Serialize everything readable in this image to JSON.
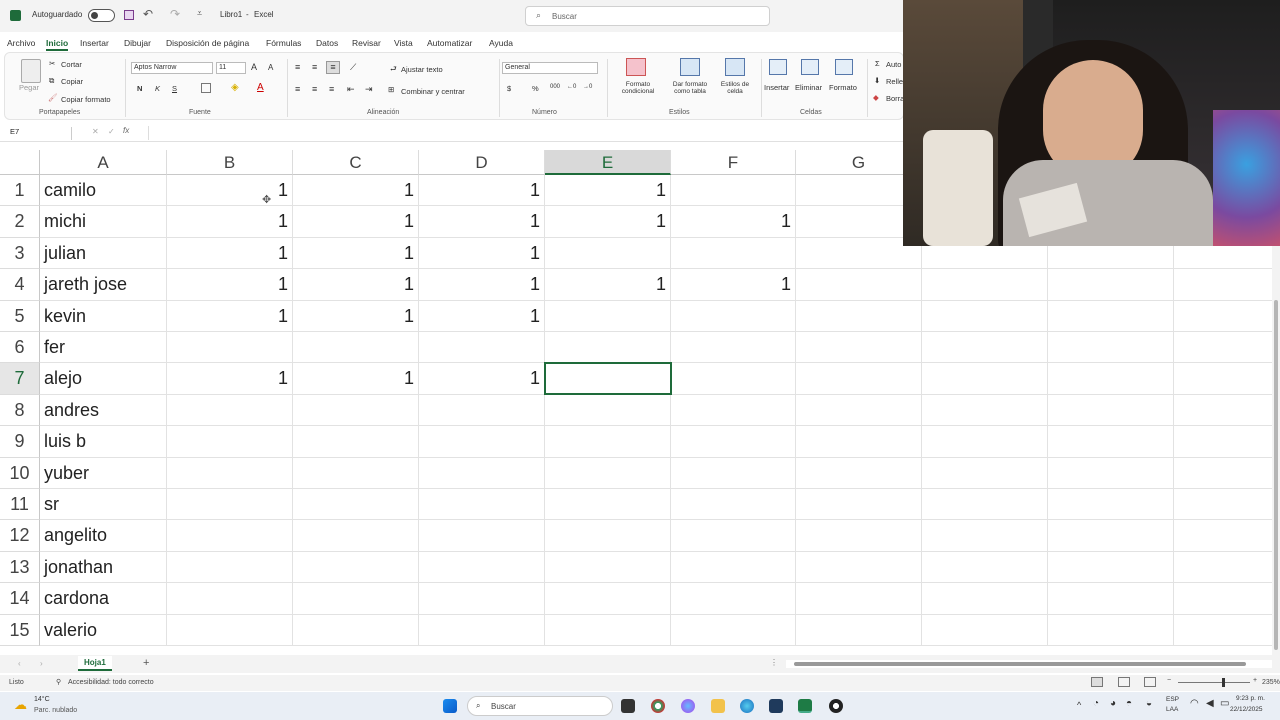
{
  "titlebar": {
    "autosave_label": "Autoguardado",
    "doc_title": "Libro1",
    "app_name": "Excel",
    "search_placeholder": "Buscar"
  },
  "menu": {
    "items": [
      "Archivo",
      "Inicio",
      "Insertar",
      "Dibujar",
      "Disposición de página",
      "Fórmulas",
      "Datos",
      "Revisar",
      "Vista",
      "Automatizar",
      "Ayuda"
    ]
  },
  "ribbon": {
    "clipboard": {
      "paste": "Pegar",
      "cut": "Cortar",
      "copy": "Copiar",
      "format_painter": "Copiar formato",
      "group": "Portapapeles"
    },
    "font": {
      "name": "Aptos Narrow",
      "size": "11",
      "bold": "N",
      "italic": "K",
      "underline": "S",
      "group": "Fuente"
    },
    "alignment": {
      "wrap": "Ajustar texto",
      "merge": "Combinar y centrar",
      "group": "Alineación"
    },
    "number": {
      "format": "General",
      "currency": "$",
      "percent": "%",
      "group": "Número"
    },
    "styles": {
      "conditional": "Formato condicional",
      "as_table": "Dar formato como tabla",
      "cell_styles": "Estilos de celda",
      "group": "Estilos"
    },
    "cells": {
      "insert": "Insertar",
      "delete": "Eliminar",
      "format": "Formato",
      "group": "Celdas"
    },
    "editing": {
      "autosum": "Auto",
      "fill": "Relle",
      "clear": "Borra"
    }
  },
  "formula_bar": {
    "name_box": "E7",
    "fx": "fx",
    "value": ""
  },
  "columns": [
    "A",
    "B",
    "C",
    "D",
    "E",
    "F",
    "G"
  ],
  "rows": [
    {
      "n": "1",
      "a": "camilo",
      "b": "1",
      "c": "1",
      "d": "1",
      "e": "1",
      "f": ""
    },
    {
      "n": "2",
      "a": "michi",
      "b": "1",
      "c": "1",
      "d": "1",
      "e": "1",
      "f": "1"
    },
    {
      "n": "3",
      "a": "julian",
      "b": "1",
      "c": "1",
      "d": "1",
      "e": "",
      "f": ""
    },
    {
      "n": "4",
      "a": "jareth jose",
      "b": "1",
      "c": "1",
      "d": "1",
      "e": "1",
      "f": "1"
    },
    {
      "n": "5",
      "a": "kevin",
      "b": "1",
      "c": "1",
      "d": "1",
      "e": "",
      "f": ""
    },
    {
      "n": "6",
      "a": "fer",
      "b": "",
      "c": "",
      "d": "",
      "e": "",
      "f": ""
    },
    {
      "n": "7",
      "a": "alejo",
      "b": "1",
      "c": "1",
      "d": "1",
      "e": "",
      "f": ""
    },
    {
      "n": "8",
      "a": "andres",
      "b": "",
      "c": "",
      "d": "",
      "e": "",
      "f": ""
    },
    {
      "n": "9",
      "a": "luis b",
      "b": "",
      "c": "",
      "d": "",
      "e": "",
      "f": ""
    },
    {
      "n": "10",
      "a": "yuber",
      "b": "",
      "c": "",
      "d": "",
      "e": "",
      "f": ""
    },
    {
      "n": "11",
      "a": "sr",
      "b": "",
      "c": "",
      "d": "",
      "e": "",
      "f": ""
    },
    {
      "n": "12",
      "a": "angelito",
      "b": "",
      "c": "",
      "d": "",
      "e": "",
      "f": ""
    },
    {
      "n": "13",
      "a": "jonathan",
      "b": "",
      "c": "",
      "d": "",
      "e": "",
      "f": ""
    },
    {
      "n": "14",
      "a": "cardona",
      "b": "",
      "c": "",
      "d": "",
      "e": "",
      "f": ""
    },
    {
      "n": "15",
      "a": "valerio",
      "b": "",
      "c": "",
      "d": "",
      "e": "",
      "f": ""
    }
  ],
  "selected_cell": "E7",
  "sheets": {
    "active": "Hoja1",
    "add": "+"
  },
  "status": {
    "ready": "Listo",
    "accessibility": "Accesibilidad: todo correcto",
    "zoom": "235%"
  },
  "taskbar": {
    "weather_temp": "14°C",
    "weather_desc": "Parc. nublado",
    "search": "Buscar",
    "lang1": "ESP",
    "lang2": "LAA",
    "time": "9:23 p. m.",
    "date": "22/12/2025"
  },
  "colors": {
    "accent": "#1e6b3a",
    "grid": "#e2e2e2"
  }
}
